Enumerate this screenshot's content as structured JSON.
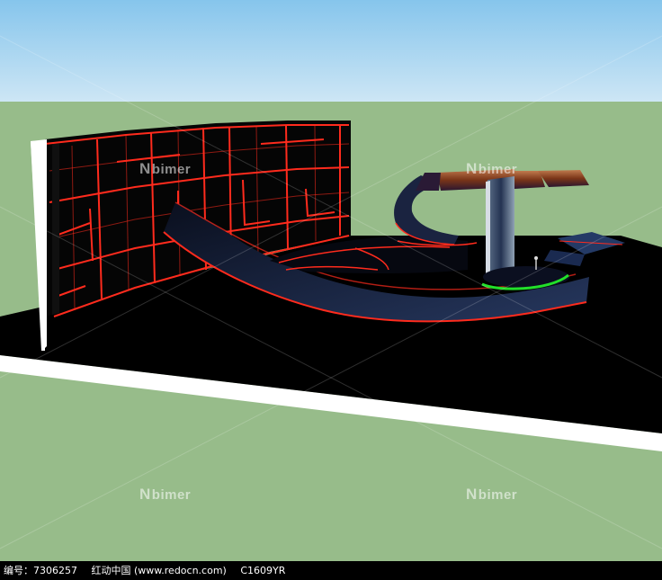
{
  "colors": {
    "sky": "#88c6ec",
    "horizon": "#cfe7f5",
    "ground": "#97bc8a",
    "floor": "#000000",
    "edge": "#ffffff",
    "neon_red": "#ff2b1d",
    "neon_green": "#22e02a",
    "ramp": "#1c2a4f",
    "panel_wood": "#8a4a2a"
  },
  "watermark": {
    "mark": "N",
    "text": "bimer"
  },
  "footer": {
    "id_label": "编号：7306257",
    "site": "红动中国 (www.redocn.com)",
    "code": "C1609YR"
  }
}
